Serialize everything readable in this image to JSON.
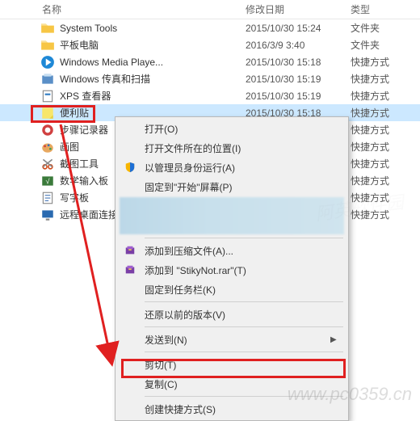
{
  "headers": {
    "name": "名称",
    "date": "修改日期",
    "type": "类型"
  },
  "files": [
    {
      "name": "System Tools",
      "date": "2015/10/30 15:24",
      "type": "文件夹",
      "icon": "folder"
    },
    {
      "name": "平板电脑",
      "date": "2016/3/9 3:40",
      "type": "文件夹",
      "icon": "folder"
    },
    {
      "name": "Windows Media Playe...",
      "date": "2015/10/30 15:18",
      "type": "快捷方式",
      "icon": "wmp"
    },
    {
      "name": "Windows 传真和扫描",
      "date": "2015/10/30 15:19",
      "type": "快捷方式",
      "icon": "fax"
    },
    {
      "name": "XPS 查看器",
      "date": "2015/10/30 15:19",
      "type": "快捷方式",
      "icon": "xps"
    },
    {
      "name": "便利贴",
      "date": "2015/10/30 15:18",
      "type": "快捷方式",
      "icon": "sticky",
      "selected": true
    },
    {
      "name": "步骤记录器",
      "date": "",
      "type": "快捷方式",
      "icon": "psr"
    },
    {
      "name": "画图",
      "date": "",
      "type": "快捷方式",
      "icon": "paint"
    },
    {
      "name": "截图工具",
      "date": "",
      "type": "快捷方式",
      "icon": "snip"
    },
    {
      "name": "数学输入板",
      "date": "",
      "type": "快捷方式",
      "icon": "math"
    },
    {
      "name": "写字板",
      "date": "",
      "type": "快捷方式",
      "icon": "wordpad"
    },
    {
      "name": "远程桌面连接",
      "date": "",
      "type": "快捷方式",
      "icon": "rdp"
    }
  ],
  "menu": {
    "open": "打开(O)",
    "open_location": "打开文件所在的位置(I)",
    "run_admin": "以管理员身份运行(A)",
    "pin_start": "固定到\"开始\"屏幕(P)",
    "obscured1": "",
    "obscured2": "",
    "add_archive": "添加到压缩文件(A)...",
    "add_sticky_rar": "添加到 \"StikyNot.rar\"(T)",
    "pin_taskbar": "固定到任务栏(K)",
    "restore": "还原以前的版本(V)",
    "send_to": "发送到(N)",
    "cut": "剪切(T)",
    "copy": "复制(C)",
    "create_shortcut": "创建快捷方式(S)"
  },
  "watermark": "www.pc0359.cn"
}
